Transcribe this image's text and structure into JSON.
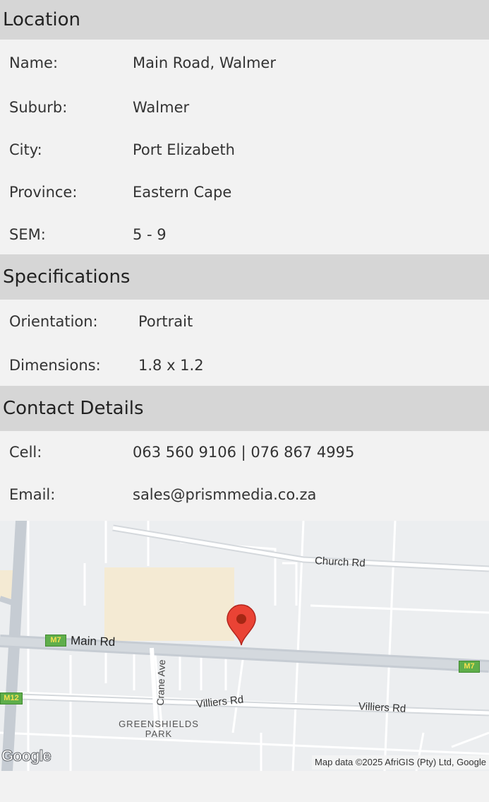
{
  "location": {
    "title": "Location",
    "fields": [
      {
        "label": "Name:",
        "value": "Main Road, Walmer"
      },
      {
        "label": "Suburb:",
        "value": "Walmer"
      },
      {
        "label": "City:",
        "value": "Port Elizabeth"
      },
      {
        "label": "Province:",
        "value": "Eastern Cape"
      },
      {
        "label": "SEM:",
        "value": "5 - 9"
      }
    ]
  },
  "specifications": {
    "title": "Specifications",
    "fields": [
      {
        "label": "Orientation:",
        "value": "Portrait"
      },
      {
        "label": "Dimensions:",
        "value": "1.8 x 1.2"
      }
    ]
  },
  "contact": {
    "title": "Contact Details",
    "fields": [
      {
        "label": "Cell:",
        "value": "063 560 9106 | 076 867 4995"
      },
      {
        "label": "Email:",
        "value": "sales@prismmedia.co.za"
      }
    ]
  },
  "map": {
    "roads": {
      "church": "Church Rd",
      "main": "Main Rd",
      "crane": "Crane Ave",
      "villiers1": "Villiers Rd",
      "villiers2": "Villiers Rd"
    },
    "shields": {
      "m7_left": "M7",
      "m7_right": "M7",
      "m12": "M12"
    },
    "area_line1": "GREENSHIELDS",
    "area_line2": "PARK",
    "logo": "Google",
    "attribution": "Map data ©2025 AfriGIS (Pty) Ltd, Google",
    "marker_color": "#ea4335"
  }
}
